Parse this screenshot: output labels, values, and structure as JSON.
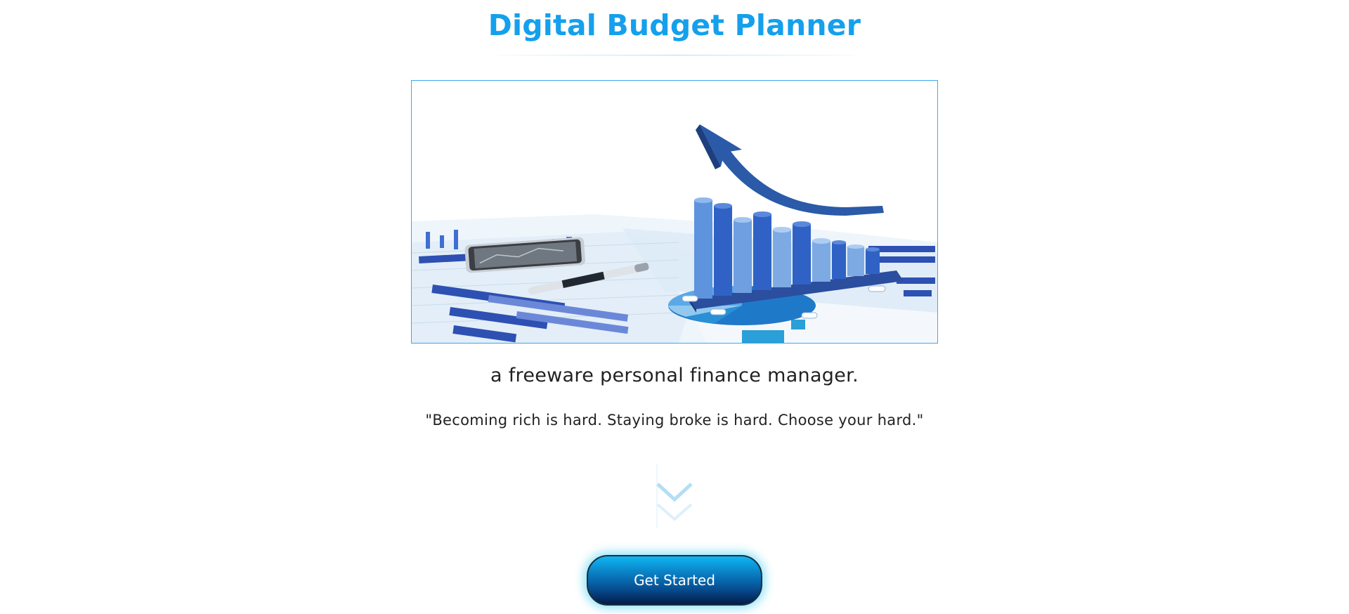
{
  "header": {
    "title": "Digital Budget Planner"
  },
  "hero": {
    "image_description_icon": "finance-chart-illustration"
  },
  "tagline": "a freeware personal finance manager.",
  "quote": "\"Becoming rich is hard. Staying broke is hard. Choose your hard.\"",
  "cta": {
    "label": "Get Started"
  },
  "colors": {
    "accent": "#14a0ec",
    "button_top": "#0fb6f2",
    "button_bottom": "#031c4a",
    "image_border": "#3aa9ec"
  }
}
